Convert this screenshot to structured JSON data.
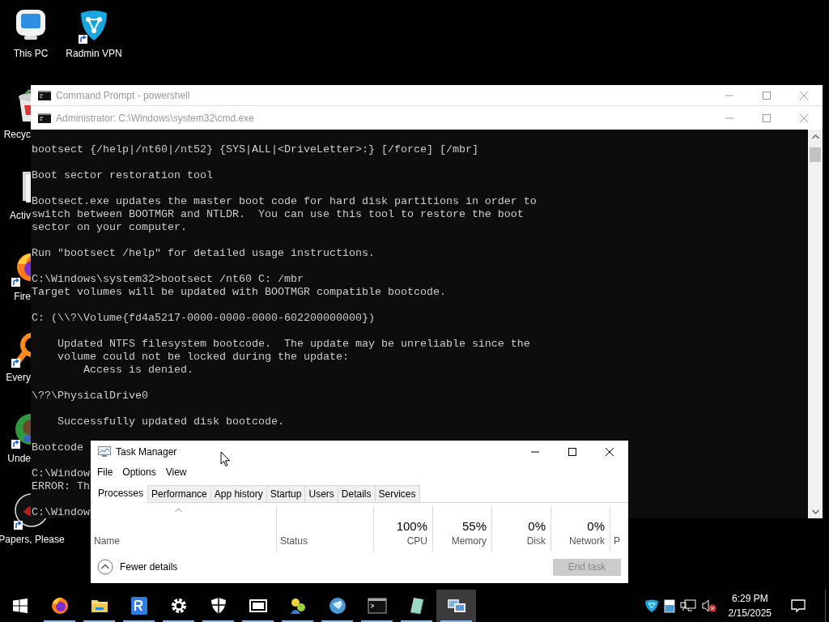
{
  "desktop_icons": [
    {
      "label": "This PC",
      "shortcut": false
    },
    {
      "label": "Radmin VPN",
      "shortcut": true
    },
    {
      "label": "Recyc",
      "shortcut": false
    },
    {
      "label": "Activ",
      "shortcut": false
    },
    {
      "label": "Fire",
      "shortcut": true
    },
    {
      "label": "Every",
      "shortcut": true
    },
    {
      "label": "Unde",
      "shortcut": true
    },
    {
      "label": "Papers, Please",
      "shortcut": true
    }
  ],
  "background_window": {
    "title": "Command Prompt - powershell"
  },
  "console_window": {
    "title": "Administrator: C:\\Windows\\system32\\cmd.exe",
    "blocks": [
      [
        "bootsect {/help|/nt60|/nt52} {SYS|ALL|<DriveLetter>:} [/force] [/mbr]"
      ],
      [
        "Boot sector restoration tool"
      ],
      [
        "Bootsect.exe updates the master boot code for hard disk partitions in order to",
        "switch between BOOTMGR and NTLDR.  You can use this tool to restore the boot",
        "sector on your computer."
      ],
      [
        "Run \"bootsect /help\" for detailed usage instructions."
      ],
      [
        "C:\\Windows\\system32>bootsect /nt60 C: /mbr",
        "Target volumes will be updated with BOOTMGR compatible bootcode."
      ],
      [
        "C: (\\\\?\\Volume{fd4a5217-0000-0000-0000-602200000000})"
      ],
      [
        "    Updated NTFS filesystem bootcode.  The update may be unreliable since the",
        "    volume could not be locked during the update:",
        "        Access is denied."
      ],
      [
        "\\??\\PhysicalDrive0"
      ],
      [
        "    Successfully updated disk bootcode."
      ],
      [
        "Bootcode"
      ],
      [
        "C:\\Window",
        "ERROR: Th"
      ],
      [
        "C:\\Window"
      ]
    ]
  },
  "task_manager": {
    "title": "Task Manager",
    "menu": [
      "File",
      "Options",
      "View"
    ],
    "tabs": [
      {
        "label": "Processes",
        "selected": true
      },
      {
        "label": "Performance",
        "selected": false
      },
      {
        "label": "App history",
        "selected": false
      },
      {
        "label": "Startup",
        "selected": false
      },
      {
        "label": "Users",
        "selected": false
      },
      {
        "label": "Details",
        "selected": false
      },
      {
        "label": "Services",
        "selected": false
      }
    ],
    "columns": [
      {
        "label": "Name",
        "sorted": true
      },
      {
        "label": "Status",
        "sorted": false
      },
      {
        "label": "CPU",
        "value": "100%",
        "sorted": false
      },
      {
        "label": "Memory",
        "value": "55%",
        "sorted": false
      },
      {
        "label": "Disk",
        "value": "0%",
        "sorted": false
      },
      {
        "label": "Network",
        "value": "0%",
        "sorted": false
      },
      {
        "label": "P",
        "sorted": false
      }
    ],
    "details_toggle": "Fewer details",
    "end_task": {
      "label": "End task",
      "disabled": true
    }
  },
  "taskbar": {
    "apps": [
      {
        "running": true,
        "selected": false
      },
      {
        "running": true,
        "selected": false
      },
      {
        "running": true,
        "selected": false
      },
      {
        "running": true,
        "selected": false
      },
      {
        "running": true,
        "selected": false
      },
      {
        "running": true,
        "selected": false
      },
      {
        "running": true,
        "selected": false
      },
      {
        "running": true,
        "selected": false
      },
      {
        "running": true,
        "selected": false
      },
      {
        "running": true,
        "selected": false
      },
      {
        "running": true,
        "selected": true
      }
    ],
    "clock": {
      "time": "6:29 PM",
      "date": "2/15/2025"
    }
  }
}
